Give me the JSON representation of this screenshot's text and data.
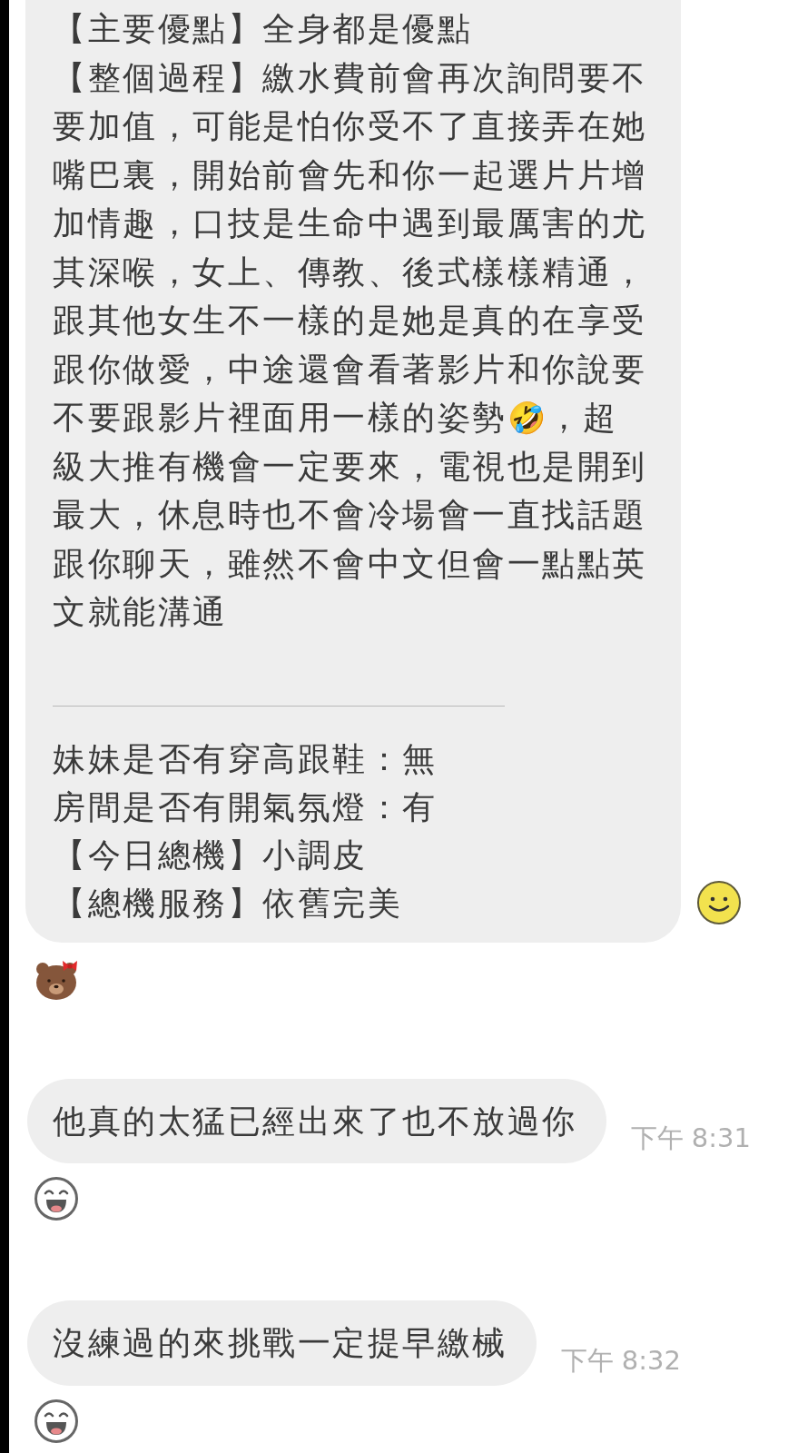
{
  "review_message": {
    "paragraphs": [
      "【主要優點】全身都是優點",
      "【整個過程】繳水費前會再次詢問要不要加值，可能是怕你受不了直接弄在她嘴巴裏，開始前會先和你一起選片片增加情趣，口技是生命中遇到最厲害的尤其深喉，女上、傳教、後式樣樣精通，跟其他女生不一樣的是她是真的在享受跟你做愛，中途還會看著影片和你說要不要跟影片裡面用一樣的姿勢🤣，超級大推有機會一定要來，電視也是開到最大，休息時也不會冷場會一直找話題跟你聊天，雖然不會中文但會一點點英文就能溝通"
    ],
    "details": [
      "妹妹是否有穿高跟鞋：無",
      "房間是否有開氣氛燈：有",
      "【今日總機】小調皮",
      "【總機服務】依舊完美"
    ]
  },
  "reply_messages": [
    {
      "text": "他真的太猛已經出來了也不放過你",
      "time": "下午 8:31"
    },
    {
      "text": "沒練過的來挑戰一定提早繳械",
      "time": "下午 8:32"
    }
  ]
}
